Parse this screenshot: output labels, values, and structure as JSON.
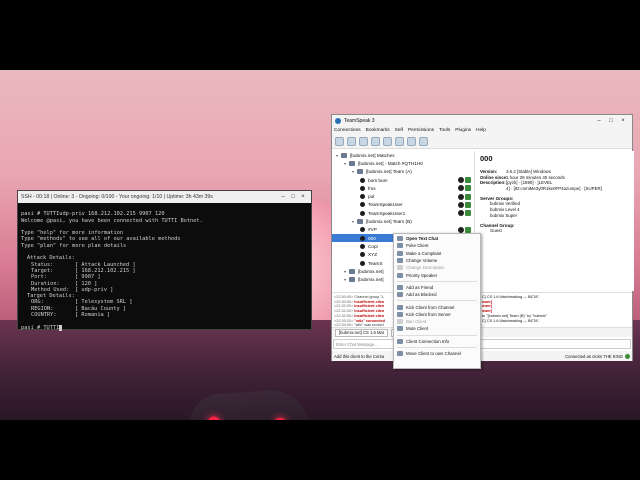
{
  "terminal": {
    "title": "SSH - 00:18 | Online: 3 - Ongoing: 0/100 - Your ongoing: 1/10 | Uptime: 3h 43m 39s",
    "command_line": "pasi # TUTTIudp-priv 168.212.102.215 9907 120",
    "welcome": "Welcome @pasi, you have been connected with TUTTI Botnet.",
    "help_line1": "Type \"help\" for more information",
    "help_line2": "Type \"methods\" to see all of our available methods",
    "help_line3": "Type \"plan\" for more plan details",
    "attack_header": "Attack Details:",
    "attack": [
      {
        "label": "Status:",
        "value": "[ Attack Launched ]"
      },
      {
        "label": "Target:",
        "value": "[ 168.212.102.215 ]"
      },
      {
        "label": "Port:",
        "value": "[ 9907 ]"
      },
      {
        "label": "Duration:",
        "value": "[ 120 ]"
      },
      {
        "label": "Method Used:",
        "value": "[ udp-priv ]"
      }
    ],
    "target_header": "Target Details:",
    "target": [
      {
        "label": "ORG:",
        "value": "[ Telesystem SRL ]"
      },
      {
        "label": "REGION:",
        "value": "[ Bacău County ]"
      },
      {
        "label": "COUNTRY:",
        "value": "[ Romania ]"
      }
    ],
    "prompt": "pasi # TUTTI"
  },
  "teamspeak": {
    "title": "TeamSpeak 3",
    "menu": [
      "Connections",
      "Bookmarks",
      "Self",
      "Permissions",
      "Tools",
      "Plugins",
      "Help"
    ],
    "tree": [
      {
        "text": "[bubmix.net] Matches",
        "kind": "chan",
        "level": 0
      },
      {
        "text": "[bubmix.net] - Match #QTH1H0",
        "kind": "chan",
        "level": 1
      },
      {
        "text": "[bubmix.net] Team (A)",
        "kind": "chan",
        "level": 2
      },
      {
        "text": "bum bum",
        "kind": "user",
        "level": 3
      },
      {
        "text": "fms",
        "kind": "user",
        "level": 3
      },
      {
        "text": "pol",
        "kind": "user",
        "level": 3
      },
      {
        "text": "TeamSpeakUser",
        "kind": "user",
        "level": 3
      },
      {
        "text": "TeamSpeakUser1",
        "kind": "user",
        "level": 3
      },
      {
        "text": "[bubmix.net] Team (B)",
        "kind": "chan",
        "level": 2
      },
      {
        "text": "#VP",
        "kind": "user",
        "level": 3
      },
      {
        "text": "000",
        "kind": "user",
        "level": 3,
        "selected": true
      },
      {
        "text": "Copi",
        "kind": "user",
        "level": 3
      },
      {
        "text": "XYZ",
        "kind": "user",
        "level": 3
      },
      {
        "text": "TeamS",
        "kind": "user",
        "level": 3
      },
      {
        "text": "[bubmix.net]",
        "kind": "chan",
        "level": 1
      },
      {
        "text": "[bubmix.net]",
        "kind": "chan",
        "level": 1
      }
    ],
    "info": {
      "name": "000",
      "rows": [
        {
          "label": "Version:",
          "value": "3.6.2 [Stable] Windows"
        },
        {
          "label": "Online since:",
          "value": "1 hour 28 minutes 40 seconds"
        },
        {
          "label": "Description:",
          "value": "[pyzk] · [1890] · [LEVEL"
        },
        {
          "label": "",
          "value": "4] · [ID:cnmiMe3y0R1ke0FP4azumpe] · [SUPER]"
        }
      ],
      "server_groups_label": "Server Groups:",
      "server_groups": [
        "bubmix Verified",
        "bubmix Level 4",
        "bubmix Super"
      ],
      "channel_group_label": "Channel Group:",
      "channel_group": "Guest"
    },
    "chat": [
      {
        "time": "<22:30:00>",
        "text": "Channel group \"L"
      },
      {
        "time": "<22:30:50>",
        "red": "Insufficient clien"
      },
      {
        "time": "<22:32:20>",
        "red": "Insufficient clien"
      },
      {
        "time": "<22:32:32>",
        "red": "Insufficient clien"
      },
      {
        "time": "<22:32:50>",
        "red": "Insufficient clien"
      },
      {
        "time": "<22:33:20>",
        "red": "\"wilz\" connected"
      },
      {
        "time": "<22:34:00>",
        "text": "\"wilz\" was moved"
      },
      {
        "time": "<22:34:00>",
        "text": "Channel group \"L"
      }
    ],
    "chat_right": [
      "C] CS 1.6 Matchmaking — BETA\".",
      "ower]",
      "ower]",
      "ower]",
      "to \"[bubmix.net] Team (B)\" by \"bubmix\"",
      "C] CS 1.6 Matchmaking — BETA\"."
    ],
    "tabs": [
      "[bubmix.net] CS 1.6 Mat",
      "ease",
      "ooon"
    ],
    "chat_placeholder": "Enter Chat Message...",
    "status_left": "Add this client to the Conta",
    "status_right": "Connected as ctoirs THE KING"
  },
  "context_menu": [
    {
      "label": "Open Text Chat",
      "bold": true
    },
    {
      "label": "Poke Client"
    },
    {
      "label": "Make a Complaint"
    },
    {
      "label": "Change Volume"
    },
    {
      "label": "Change Description",
      "disabled": true
    },
    {
      "label": "Priority Speaker"
    },
    {
      "sep": true
    },
    {
      "label": "Add as Friend"
    },
    {
      "label": "Add as Blocked"
    },
    {
      "sep": true
    },
    {
      "label": "Kick Client from Channel"
    },
    {
      "label": "Kick Client from Server"
    },
    {
      "label": "Ban Client",
      "disabled": true
    },
    {
      "label": "Mute Client"
    },
    {
      "sep": true
    },
    {
      "label": "Client Connection Info"
    },
    {
      "sep": true
    },
    {
      "label": "Move Client to own Channel"
    }
  ]
}
